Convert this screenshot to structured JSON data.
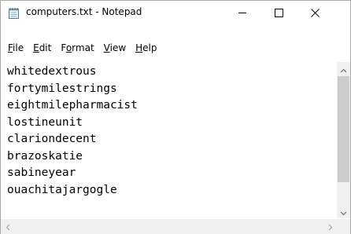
{
  "window": {
    "title": "computers.txt - Notepad",
    "icon": "notepad-icon"
  },
  "caption_buttons": {
    "minimize_icon": "minimize-icon",
    "maximize_icon": "maximize-icon",
    "close_icon": "close-icon"
  },
  "menu": [
    {
      "accel": "F",
      "rest": "ile"
    },
    {
      "accel": "E",
      "rest": "dit"
    },
    {
      "pre": "F",
      "accel": "o",
      "rest": "rmat"
    },
    {
      "accel": "V",
      "rest": "iew"
    },
    {
      "accel": "H",
      "rest": "elp"
    }
  ],
  "editor": {
    "lines": [
      "whitedextrous",
      "fortymilestrings",
      "eightmilepharmacist",
      "lostineunit",
      "clariondecent",
      "brazoskatie",
      "sabineyear",
      "ouachitajargogle"
    ]
  },
  "colors": {
    "scrollbar_track": "#f0f0f0",
    "scrollbar_thumb": "#cdcdcd",
    "text": "#000000"
  }
}
